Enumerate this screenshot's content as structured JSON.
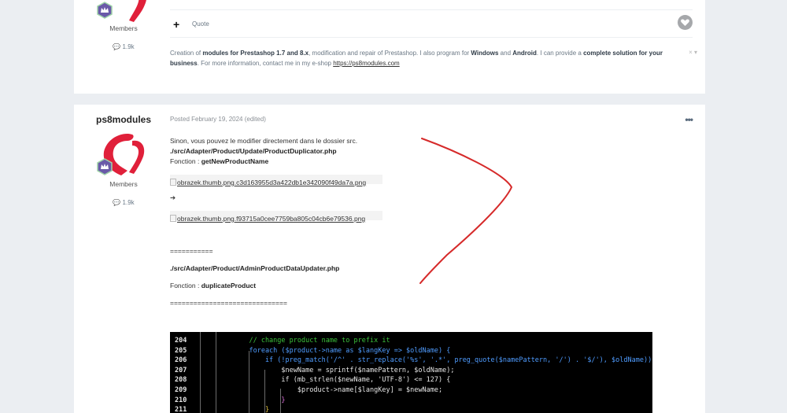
{
  "post1": {
    "role": "Members",
    "reputation": "1.9k",
    "actions": {
      "add_label": "+",
      "quote_label": "Quote"
    },
    "signature": {
      "t1": "Creation of ",
      "b1": "modules for Prestashop 1.7 and 8.x",
      "t2": ", modification and repair of Prestashop. I also program for ",
      "b2": "Windows",
      "t3": " and ",
      "b3": "Android",
      "t4": ". I can provide a ",
      "b4": "complete solution for your business",
      "t5": ". For more information, contact me in my e-shop ",
      "link": "https://ps8modules.com",
      "close": "× ▾"
    }
  },
  "post2": {
    "username": "ps8modules",
    "role": "Members",
    "reputation": "1.9k",
    "meta": "Posted February 19, 2024 (edited)",
    "more": "•••",
    "body": {
      "line1": "Sinon, vous pouvez le modifier directement dans le dossier src.",
      "path1": "./src/Adapter/Product/Update/ProductDuplicator.php",
      "fn_prefix1": "Fonction : ",
      "fn1": "getNewProductName",
      "img1": "obrazek.thumb.png.c3d163955d3a422db1e342090f49da7a.png",
      "arrow": "➔",
      "img2": "obrazek.thumb.png.f93715a0cee7759ba805c04cb6e79536.png",
      "sep1": "===========",
      "path2": "./src/Adapter/Product/AdminProductDataUpdater.php",
      "fn_prefix2": "Fonction : ",
      "fn2": "duplicateProduct",
      "sep2": "=============================="
    },
    "code": {
      "lines": [
        {
          "n": "204",
          "code": "    // change product name to prefix it"
        },
        {
          "n": "205",
          "code": "    foreach ($product->name as $langKey => $oldName) {"
        },
        {
          "n": "206",
          "code": "        if (!preg_match('/^' . str_replace('%s', '.*', preg_quote($namePattern, '/') . '$/'), $oldName)) {"
        },
        {
          "n": "207",
          "code": "            $newName = sprintf($namePattern, $oldName);"
        },
        {
          "n": "208",
          "code": "            if (mb_strlen($newName, 'UTF-8') <= 127) {"
        },
        {
          "n": "209",
          "code": "                $product->name[$langKey] = $newName;"
        },
        {
          "n": "210",
          "code": "            }"
        },
        {
          "n": "211",
          "code": "        }"
        }
      ]
    }
  },
  "colors": {
    "annotation": "#d62a2a",
    "avatar": "#e0203a",
    "badge": "#6a5aa8"
  }
}
